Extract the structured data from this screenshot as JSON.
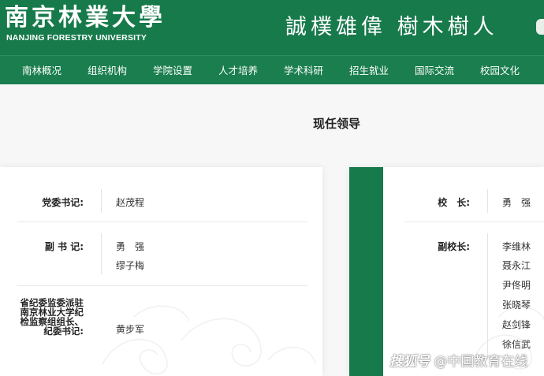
{
  "header": {
    "logo_cn": "南京林業大學",
    "logo_en": "NANJING FORESTRY UNIVERSITY",
    "motto": "誠樸雄偉 樹木樹人"
  },
  "nav": {
    "items": [
      "南林概况",
      "组织机构",
      "学院设置",
      "人才培养",
      "学术科研",
      "招生就业",
      "国际交流",
      "校园文化"
    ]
  },
  "page": {
    "title": "现任领导"
  },
  "left": {
    "rows": [
      {
        "label": "党委书记:",
        "values": [
          "赵茂程"
        ]
      },
      {
        "label": "副 书 记:",
        "values": [
          "勇　强",
          "缪子梅"
        ]
      },
      {
        "label_lines": [
          "省纪委监委派驻",
          "南京林业大学纪",
          "检监察组组长、",
          "纪委书记:"
        ],
        "values": [
          "黄步军"
        ]
      }
    ]
  },
  "right": {
    "rows": [
      {
        "label": "校　长:",
        "values": [
          "勇　强"
        ]
      },
      {
        "label": "副校长:",
        "values": [
          "李维林",
          "聂永江",
          "尹佟明",
          "张晓琴",
          "赵剑锋",
          "徐信武"
        ]
      }
    ]
  },
  "watermark": {
    "logo": "搜狐号",
    "text": "@中国教育在线"
  },
  "colors": {
    "brand_green": "#177a4b",
    "nav_green": "#1a7e4e"
  }
}
